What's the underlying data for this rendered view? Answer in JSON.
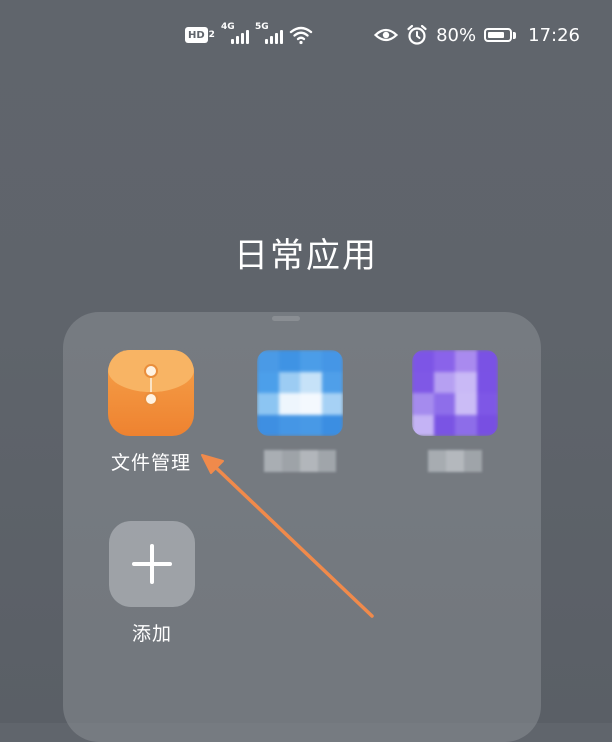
{
  "status_bar": {
    "hd_badge": "HD",
    "hd_sub": "2",
    "network_1": "4G",
    "network_2": "5G",
    "battery_percent": "80%",
    "battery_level": 0.8,
    "time": "17:26",
    "icons": [
      "hd-icon",
      "signal-4g-icon",
      "signal-5g-icon",
      "wifi-icon",
      "eye-icon",
      "alarm-icon",
      "battery-icon"
    ]
  },
  "folder": {
    "title": "日常应用",
    "apps": [
      {
        "label": "文件管理",
        "icon": "file-manager-icon"
      },
      {
        "label": "",
        "icon": "cloud-app-icon",
        "blurred": true
      },
      {
        "label": "",
        "icon": "purple-app-icon",
        "blurred": true
      },
      {
        "label": "添加",
        "icon": "add-icon"
      }
    ]
  },
  "annotation": {
    "type": "arrow",
    "color": "#f08a4b"
  }
}
